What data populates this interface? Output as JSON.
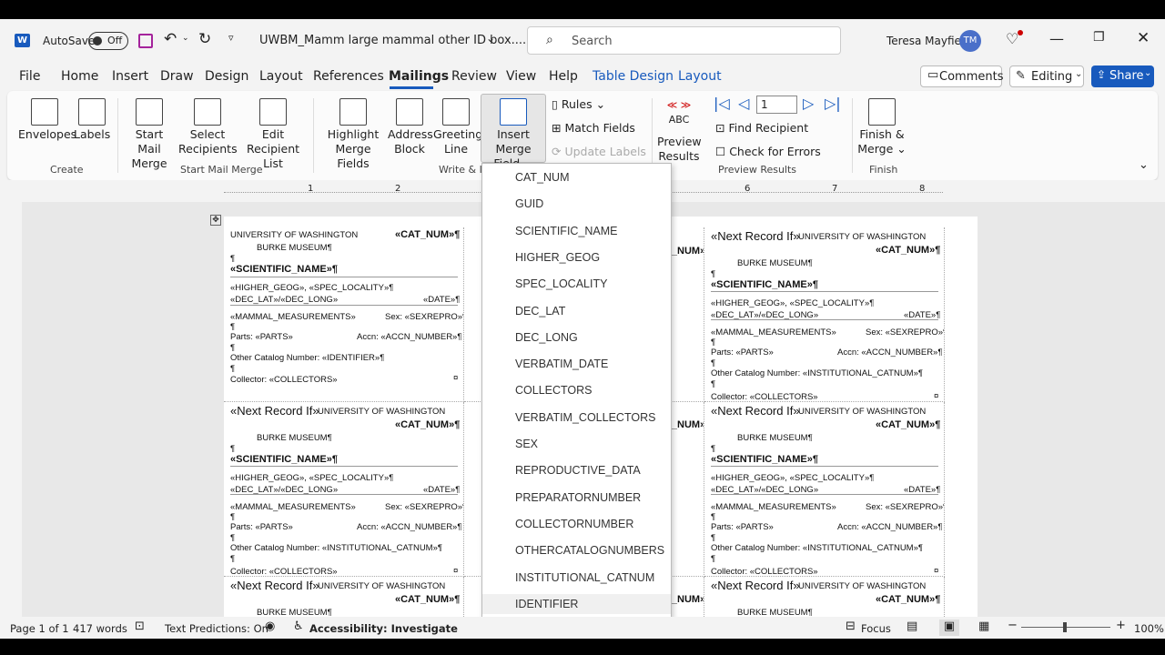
{
  "titlebar": {
    "autosave_label": "AutoSave",
    "toggle_label": "Off",
    "doc_title": "UWBM_Mamm large mammal other ID box....",
    "search_placeholder": "Search",
    "user_name": "Teresa Mayfield",
    "user_initials": "TM"
  },
  "menu": {
    "file": "File",
    "home": "Home",
    "insert": "Insert",
    "draw": "Draw",
    "design": "Design",
    "layout": "Layout",
    "references": "References",
    "mailings": "Mailings",
    "review": "Review",
    "view": "View",
    "help": "Help",
    "table_design": "Table Design",
    "layout2": "Layout",
    "comments": "Comments",
    "editing": "Editing",
    "share": "Share"
  },
  "ribbon": {
    "envelopes": "Envelopes",
    "labels": "Labels",
    "create": "Create",
    "start_mail_merge_1": "Start Mail",
    "start_mail_merge_2": "Merge",
    "select_recipients_1": "Select",
    "select_recipients_2": "Recipients",
    "edit_list_1": "Edit",
    "edit_list_2": "Recipient List",
    "group_start": "Start Mail Merge",
    "highlight_1": "Highlight",
    "highlight_2": "Merge Fields",
    "address_1": "Address",
    "address_2": "Block",
    "greeting_1": "Greeting",
    "greeting_2": "Line",
    "insert_merge_1": "Insert Merge",
    "insert_merge_2": "Field",
    "group_write": "Write & In",
    "rules": "Rules",
    "match_fields": "Match Fields",
    "update_labels": "Update Labels",
    "abc": "ABC",
    "preview_1": "Preview",
    "preview_2": "Results",
    "record_value": "1",
    "find_recipient": "Find Recipient",
    "check_errors": "Check for Errors",
    "group_preview": "Preview Results",
    "finish_1": "Finish &",
    "finish_2": "Merge",
    "group_finish": "Finish"
  },
  "ruler": {
    "ticks": [
      "1",
      "2",
      "6",
      "7",
      "8"
    ]
  },
  "label_lines": {
    "next_record": "«Next Record If»",
    "uw": "UNIVERSITY OF WASHINGTON",
    "catnum": "«CAT_NUM»¶",
    "burke": "BURKE MUSEUM¶",
    "para": "¶",
    "sci": "«SCIENTIFIC_NAME»¶",
    "geog": "«HIGHER_GEOG», «SPEC_LOCALITY»¶",
    "latlong": "«DEC_LAT»/«DEC_LONG»",
    "date": "«DATE»¶",
    "meas": "«MAMMAL_MEASUREMENTS»",
    "sex": "Sex: «SEXREPRO»¶",
    "parts": "Parts: «PARTS»",
    "accn": "Accn: «ACCN_NUMBER»¶",
    "other_id": "Other Catalog Number: «IDENTIFIER»¶",
    "other_inst": "Other Catalog Number: «INSTITUTIONAL_CATNUM»¶",
    "collector": "Collector: «COLLECTORS»",
    "cell_end": "¤"
  },
  "dropdown": {
    "items": [
      "CAT_NUM",
      "GUID",
      "SCIENTIFIC_NAME",
      "HIGHER_GEOG",
      "SPEC_LOCALITY",
      "DEC_LAT",
      "DEC_LONG",
      "VERBATIM_DATE",
      "COLLECTORS",
      "VERBATIM_COLLECTORS",
      "SEX",
      "REPRODUCTIVE_DATA",
      "PREPARATORNUMBER",
      "COLLECTORNUMBER",
      "OTHERCATALOGNUMBERS",
      "INSTITUTIONAL_CATNUM",
      "IDENTIFIER"
    ]
  },
  "status": {
    "page": "Page 1 of 1",
    "words": "417 words",
    "predictions": "Text Predictions: On",
    "accessibility": "Accessibility: Investigate",
    "focus": "Focus",
    "zoom": "100%"
  },
  "colors": {
    "accent": "#185abd",
    "share": "#185abd",
    "mailings_underline": "#185abd"
  }
}
